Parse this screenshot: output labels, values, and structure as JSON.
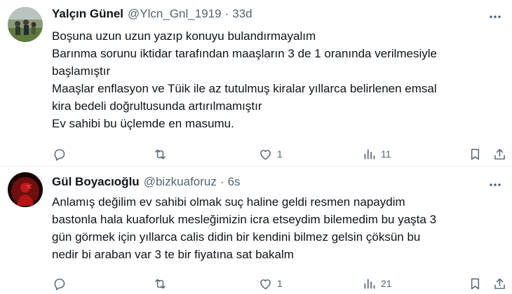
{
  "tweets": [
    {
      "author_name": "Yalçın Günel",
      "handle": "@Ylcn_Gnl_1919",
      "separator": "·",
      "time": "33d",
      "lines": [
        "Boşuna uzun uzun yazıp konuyu bulandırmayalım",
        "Barınma sorunu iktidar tarafından maaşların 3 de 1 oranında verilmesiyle",
        "başlamıştır",
        "Maaşlar enflasyon ve Tüik ile az tutulmuş kiralar yıllarca belirlenen emsal",
        "kira bedeli doğrultusunda artırılmamıştır",
        "Ev sahibi bu üçlemde en masumu."
      ],
      "reply_count": "",
      "retweet_count": "",
      "like_count": "1",
      "view_count": "11"
    },
    {
      "author_name": "Gül Boyacıoğlu",
      "handle": "@bizkuaforuz",
      "separator": "·",
      "time": "6s",
      "lines": [
        "Anlamış değilim ev sahibi olmak suç haline geldi resmen napaydim",
        "bastonla hala kuaforluk mesleğimizin icra etseydim bilemedim bu yaşta 3",
        "gün görmek için yıllarca calis didin bir kendini bilmez gelsin çöksün  bu",
        "nedir bi araban var 3 te bir fiyatına sat bakalm"
      ],
      "reply_count": "",
      "retweet_count": "",
      "like_count": "1",
      "view_count": "21"
    }
  ],
  "colors": {
    "text_primary": "#0f1419",
    "text_secondary": "#536471",
    "divider": "#eff3f4",
    "background": "#ffffff"
  },
  "icons": {
    "reply": "reply-icon",
    "retweet": "retweet-icon",
    "like": "heart-icon",
    "views": "views-icon",
    "bookmark": "bookmark-icon",
    "share": "share-icon",
    "more": "more-options-icon"
  }
}
